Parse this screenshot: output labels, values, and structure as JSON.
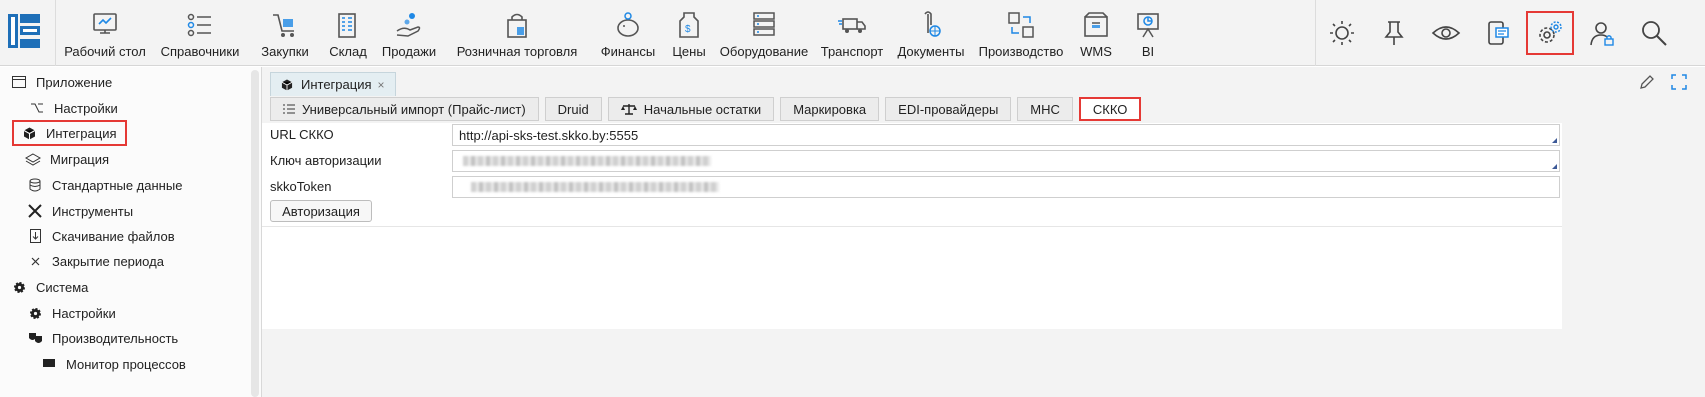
{
  "toolbar": {
    "modules": [
      {
        "label": "Рабочий стол",
        "icon": "desktop-icon"
      },
      {
        "label": "Справочники",
        "icon": "list-icon"
      },
      {
        "label": "Закупки",
        "icon": "cart-icon"
      },
      {
        "label": "Склад",
        "icon": "warehouse-icon"
      },
      {
        "label": "Продажи",
        "icon": "sales-hand-icon"
      },
      {
        "label": "Розничная торговля",
        "icon": "retail-bag-icon"
      },
      {
        "label": "Финансы",
        "icon": "piggy-bank-icon"
      },
      {
        "label": "Цены",
        "icon": "price-tag-icon"
      },
      {
        "label": "Оборудование",
        "icon": "server-icon"
      },
      {
        "label": "Транспорт",
        "icon": "truck-icon"
      },
      {
        "label": "Документы",
        "icon": "pen-globe-icon"
      },
      {
        "label": "Производство",
        "icon": "production-icon"
      },
      {
        "label": "WMS",
        "icon": "box-icon"
      },
      {
        "label": "BI",
        "icon": "presentation-icon"
      }
    ],
    "tools": [
      {
        "name": "theme-icon"
      },
      {
        "name": "pin-icon"
      },
      {
        "name": "eye-icon"
      },
      {
        "name": "chat-icon"
      },
      {
        "name": "settings-gear-icon",
        "highlight": true
      },
      {
        "name": "user-lock-icon"
      },
      {
        "name": "search-icon"
      }
    ]
  },
  "sidebar": {
    "items": [
      {
        "label": "Приложение",
        "icon": "window-icon"
      },
      {
        "label": "Настройки",
        "icon": "option-key-icon"
      },
      {
        "label": "Интеграция",
        "icon": "cube-icon",
        "selected": true
      },
      {
        "label": "Миграция",
        "icon": "layers-icon"
      },
      {
        "label": "Стандартные данные",
        "icon": "database-icon"
      },
      {
        "label": "Инструменты",
        "icon": "tools-icon"
      },
      {
        "label": "Скачивание файлов",
        "icon": "download-file-icon"
      },
      {
        "label": "Закрытие периода",
        "icon": "close-x-icon"
      },
      {
        "label": "Система",
        "icon": "gear-icon"
      },
      {
        "label": "Настройки",
        "icon": "gear-icon"
      },
      {
        "label": "Производительность",
        "icon": "masks-icon"
      },
      {
        "label": "Монитор процессов",
        "icon": "monitor-icon"
      }
    ]
  },
  "document_tab": {
    "label": "Интеграция",
    "close": "×"
  },
  "subtabs": [
    {
      "label": "Универсальный импорт (Прайс-лист)",
      "icon": "list-icon"
    },
    {
      "label": "Druid"
    },
    {
      "label": "Начальные остатки",
      "icon": "scales-icon"
    },
    {
      "label": "Маркировка"
    },
    {
      "label": "EDI-провайдеры"
    },
    {
      "label": "МНС"
    },
    {
      "label": "СККО",
      "active": true
    }
  ],
  "form": {
    "url_label": "URL СККО",
    "url_value": "http://api-sks-test.skko.by:5555",
    "auth_key_label": "Ключ авторизации",
    "token_label": "skkoToken",
    "auth_button": "Авторизация"
  },
  "colors": {
    "highlight": "#e53935",
    "accent": "#1e88e5",
    "tab_bg": "#e4eef2"
  }
}
